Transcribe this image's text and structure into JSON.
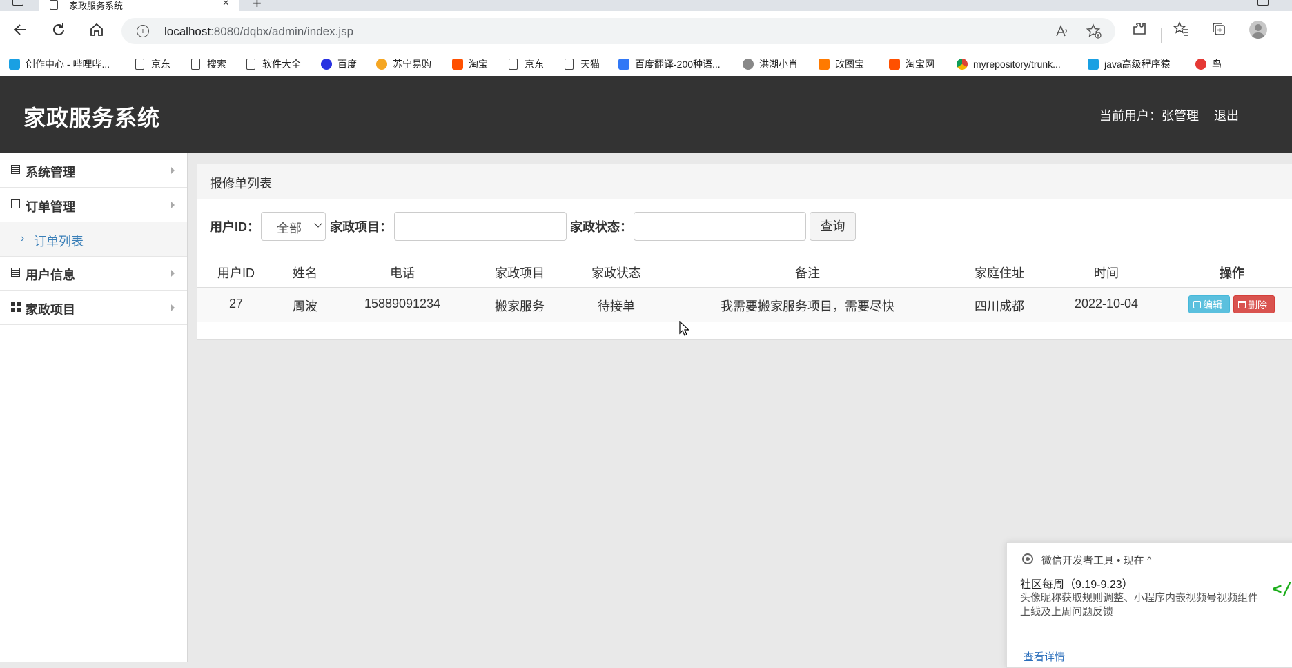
{
  "browser": {
    "tab_title": "家政服务系统",
    "tab_close": "×",
    "new_tab": "+",
    "url_host": "localhost",
    "url_rest": ":8080/dqbx/admin/index.jsp"
  },
  "bookmarks": [
    {
      "label": "创作中心 - 哔哩哔...",
      "icon": "bilibili-icon",
      "color": "#19a0e3"
    },
    {
      "label": "京东",
      "icon": "page-icon"
    },
    {
      "label": "搜索",
      "icon": "page-icon"
    },
    {
      "label": "软件大全",
      "icon": "page-icon"
    },
    {
      "label": "百度",
      "icon": "baidu-icon",
      "color": "#2932e1"
    },
    {
      "label": "苏宁易购",
      "icon": "suning-icon",
      "color": "#f5a623"
    },
    {
      "label": "淘宝",
      "icon": "taobao-icon",
      "color": "#ff5000"
    },
    {
      "label": "京东",
      "icon": "page-icon"
    },
    {
      "label": "天猫",
      "icon": "page-icon"
    },
    {
      "label": "百度翻译-200种语...",
      "icon": "fanyi-icon",
      "color": "#3178f6"
    },
    {
      "label": "洪湖小肖",
      "icon": "bird-icon",
      "color": "#666666"
    },
    {
      "label": "改图宝",
      "icon": "gaitubao-icon",
      "color": "#ff7a00"
    },
    {
      "label": "淘宝网",
      "icon": "taobao-icon",
      "color": "#ff5000"
    },
    {
      "label": "myrepository/trunk...",
      "icon": "chrome-icon",
      "color": "#db4437"
    },
    {
      "label": "java高级程序猿",
      "icon": "bilibili-icon",
      "color": "#19a0e3"
    },
    {
      "label": "鸟",
      "icon": "bird-icon",
      "color": "#e53935"
    }
  ],
  "header": {
    "title": "家政服务系统",
    "current_user": "当前用户：张管理",
    "logout": "退出"
  },
  "sidebar": {
    "items": [
      {
        "label": "系统管理",
        "icon": "list-icon"
      },
      {
        "label": "订单管理",
        "icon": "list-icon"
      },
      {
        "label": "用户信息",
        "icon": "list-icon"
      },
      {
        "label": "家政项目",
        "icon": "grid-icon"
      }
    ],
    "submenu": {
      "label": "订单列表",
      "active_color": "#3a7fb8"
    }
  },
  "panel": {
    "title": "报修单列表",
    "filters": {
      "user_id_label": "用户ID：",
      "user_id_value": "全部",
      "project_label": "家政项目：",
      "project_value": "",
      "status_label": "家政状态：",
      "status_value": "",
      "query_button": "查询"
    },
    "table": {
      "columns": [
        "用户ID",
        "姓名",
        "电话",
        "家政项目",
        "家政状态",
        "备注",
        "家庭住址",
        "时间",
        "操作"
      ],
      "rows": [
        {
          "user_id": "27",
          "name": "周波",
          "phone": "15889091234",
          "project": "搬家服务",
          "status": "待接单",
          "remark": "我需要搬家服务项目，需要尽快",
          "address": "四川成都",
          "time": "2022-10-04",
          "edit": "编辑",
          "delete": "删除"
        }
      ]
    }
  },
  "notification": {
    "source": "微信开发者工具 • 现在 ^",
    "heading": "社区每周（9.19-9.23）",
    "body": "头像昵称获取规则调整、小程序内嵌视频号视频组件上线及上周问题反馈",
    "link": "查看详情",
    "dev_icon": "</>"
  },
  "colors": {
    "header_bg": "#333333",
    "accent": "#3a7fb8",
    "edit_btn": "#5bc0de",
    "delete_btn": "#d9534f"
  }
}
